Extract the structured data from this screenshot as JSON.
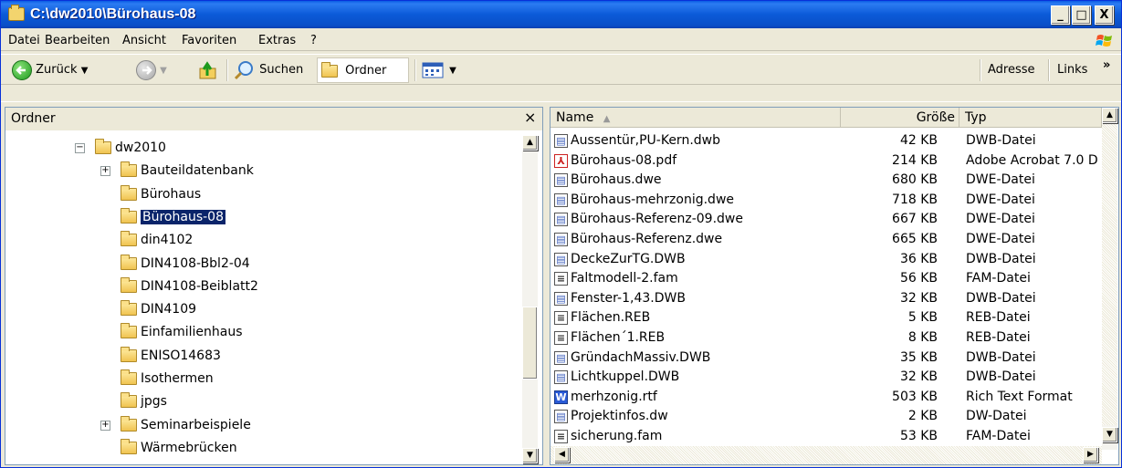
{
  "window": {
    "title": "C:\\dw2010\\Bürohaus-08",
    "minimize": "_",
    "maximize": "□",
    "close": "X"
  },
  "menu": {
    "items": [
      "Datei",
      "Bearbeiten",
      "Ansicht",
      "Favoriten",
      "Extras",
      "?"
    ]
  },
  "toolbar": {
    "back": "Zurück",
    "search": "Suchen",
    "folders": "Ordner",
    "address": "Adresse",
    "links": "Links",
    "chevron": "»"
  },
  "tree": {
    "header": "Ordner",
    "close": "×",
    "items": [
      {
        "label": "dw2010",
        "expander": "−"
      },
      {
        "label": "Bauteildatenbank",
        "expander": "+"
      },
      {
        "label": "Bürohaus",
        "expander": ""
      },
      {
        "label": "Bürohaus-08",
        "expander": ""
      },
      {
        "label": "din4102",
        "expander": ""
      },
      {
        "label": "DIN4108-Bbl2-04",
        "expander": ""
      },
      {
        "label": "DIN4108-Beiblatt2",
        "expander": ""
      },
      {
        "label": "DIN4109",
        "expander": ""
      },
      {
        "label": "Einfamilienhaus",
        "expander": ""
      },
      {
        "label": "ENISO14683",
        "expander": ""
      },
      {
        "label": "Isothermen",
        "expander": ""
      },
      {
        "label": "jpgs",
        "expander": ""
      },
      {
        "label": "Seminarbeispiele",
        "expander": "+"
      },
      {
        "label": "Wärmebrücken",
        "expander": ""
      }
    ]
  },
  "list": {
    "columns": {
      "name": "Name",
      "size": "Größe",
      "type": "Typ"
    },
    "files": [
      {
        "name": "Aussentür,PU-Kern.dwb",
        "size": "42 KB",
        "type": "DWB-Datei"
      },
      {
        "name": "Bürohaus-08.pdf",
        "size": "214 KB",
        "type": "Adobe Acrobat 7.0 D"
      },
      {
        "name": "Bürohaus.dwe",
        "size": "680 KB",
        "type": "DWE-Datei"
      },
      {
        "name": "Bürohaus-mehrzonig.dwe",
        "size": "718 KB",
        "type": "DWE-Datei"
      },
      {
        "name": "Bürohaus-Referenz-09.dwe",
        "size": "667 KB",
        "type": "DWE-Datei"
      },
      {
        "name": "Bürohaus-Referenz.dwe",
        "size": "665 KB",
        "type": "DWE-Datei"
      },
      {
        "name": "DeckeZurTG.DWB",
        "size": "36 KB",
        "type": "DWB-Datei"
      },
      {
        "name": "Faltmodell-2.fam",
        "size": "56 KB",
        "type": "FAM-Datei"
      },
      {
        "name": "Fenster-1,43.DWB",
        "size": "32 KB",
        "type": "DWB-Datei"
      },
      {
        "name": "Flächen.REB",
        "size": "5 KB",
        "type": "REB-Datei"
      },
      {
        "name": "Flächen´1.REB",
        "size": "8 KB",
        "type": "REB-Datei"
      },
      {
        "name": "GründachMassiv.DWB",
        "size": "35 KB",
        "type": "DWB-Datei"
      },
      {
        "name": "Lichtkuppel.DWB",
        "size": "32 KB",
        "type": "DWB-Datei"
      },
      {
        "name": "merhzonig.rtf",
        "size": "503 KB",
        "type": "Rich Text Format"
      },
      {
        "name": "Projektinfos.dw",
        "size": "2 KB",
        "type": "DW-Datei"
      },
      {
        "name": "sicherung.fam",
        "size": "53 KB",
        "type": "FAM-Datei"
      }
    ]
  }
}
